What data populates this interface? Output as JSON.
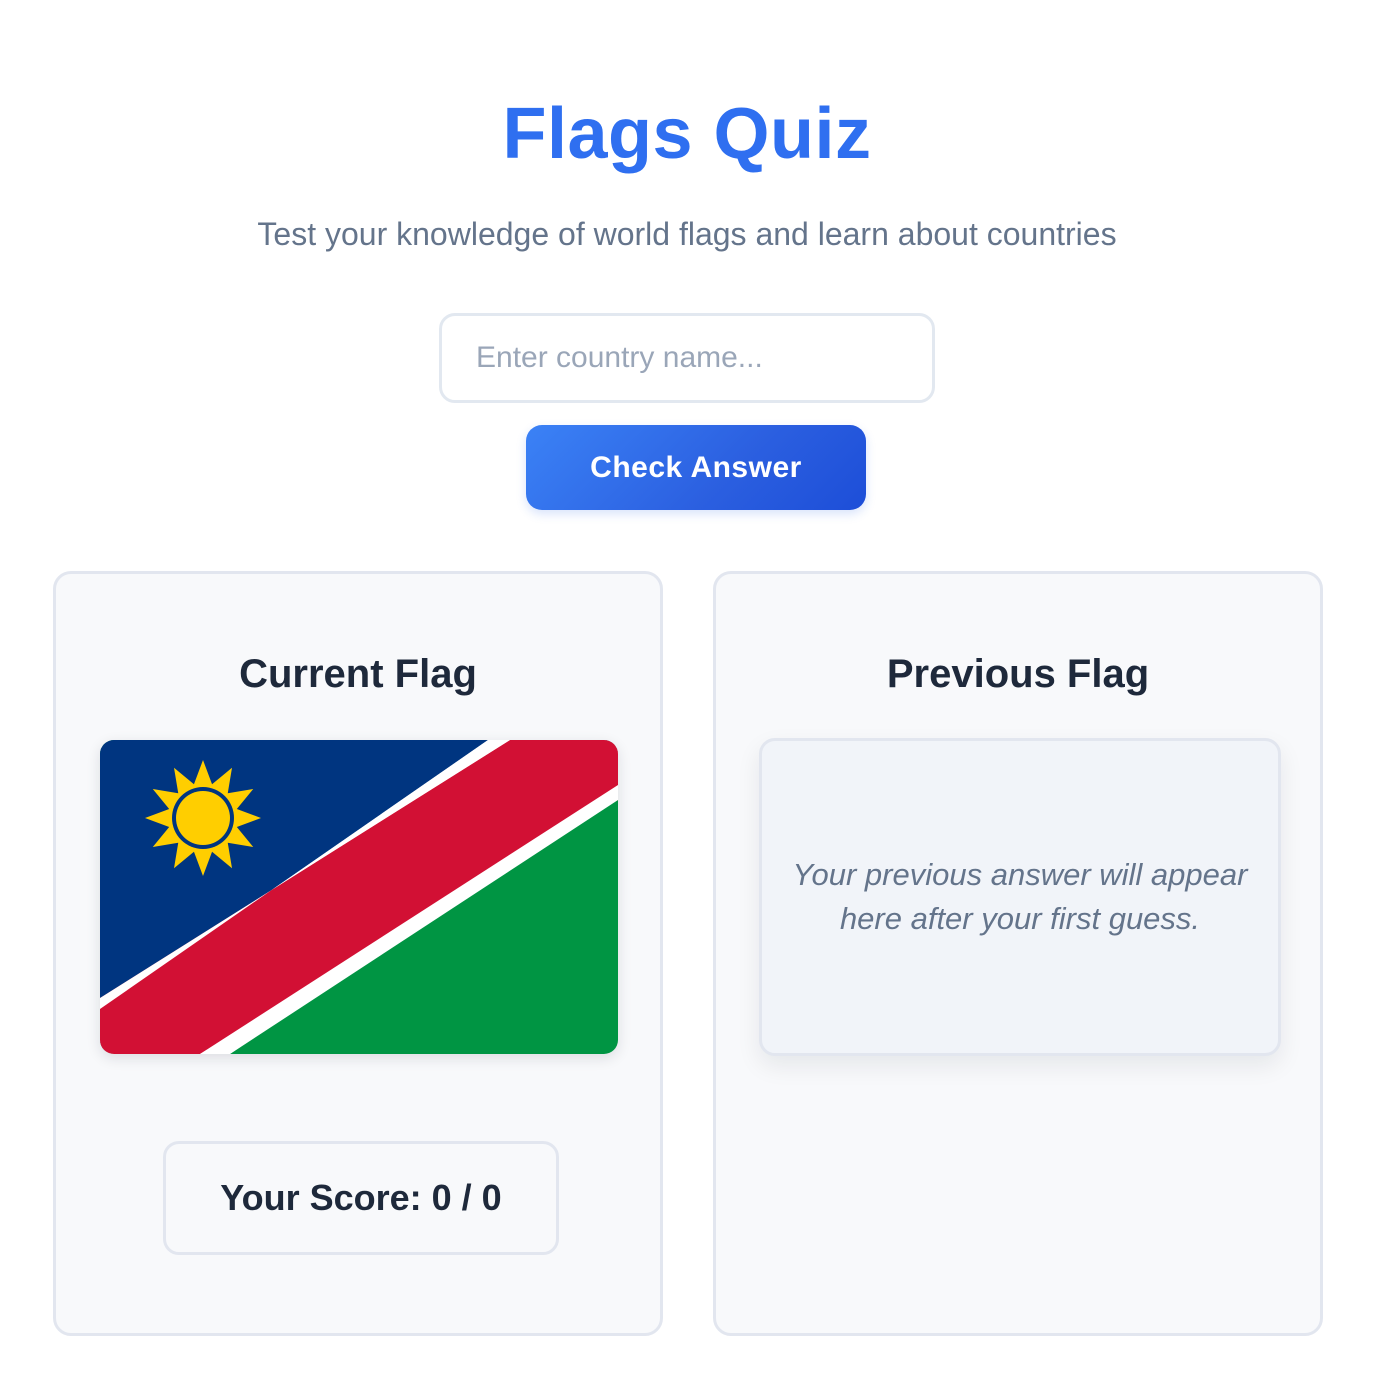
{
  "header": {
    "title": "Flags Quiz",
    "subtitle": "Test your knowledge of world flags and learn about countries"
  },
  "answer": {
    "placeholder": "Enter country name...",
    "value": "",
    "submit_label": "Check Answer"
  },
  "current_card": {
    "title": "Current Flag",
    "flag_icon": "namibia-flag",
    "score_label": "Your Score:",
    "score_value": "0 / 0"
  },
  "previous_card": {
    "title": "Previous Flag",
    "placeholder_text": "Your previous answer will appear here after your first guess."
  },
  "colors": {
    "accent": "#2f6ff0",
    "button_gradient_start": "#3b82f6",
    "button_gradient_end": "#1d4ed8",
    "text_dark": "#1e293b",
    "text_muted": "#64748b",
    "flag_blue": "#003580",
    "flag_red": "#d21034",
    "flag_green": "#009543",
    "flag_sun": "#ffce00"
  }
}
